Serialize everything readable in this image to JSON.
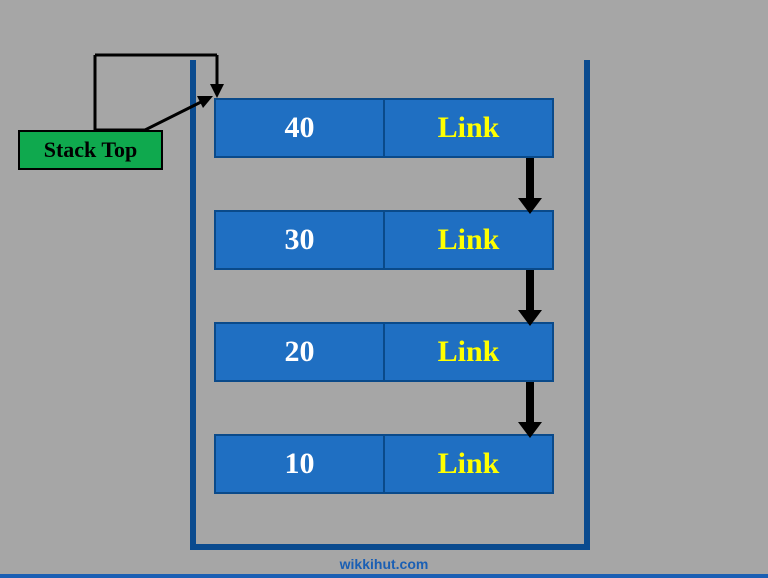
{
  "label": {
    "stack_top": "Stack Top"
  },
  "nodes": [
    {
      "value": "40",
      "link": "Link"
    },
    {
      "value": "30",
      "link": "Link"
    },
    {
      "value": "20",
      "link": "Link"
    },
    {
      "value": "10",
      "link": "Link"
    }
  ],
  "watermark": "wikkihut.com",
  "colors": {
    "background": "#a6a6a6",
    "container_border": "#0a4b8f",
    "node_fill": "#1f6fc2",
    "node_border": "#0a4a8a",
    "value_text": "#ffffff",
    "link_text": "#ffff00",
    "label_fill": "#0fa94e",
    "label_border": "#000000",
    "watermark_text": "#1a5fb4"
  }
}
